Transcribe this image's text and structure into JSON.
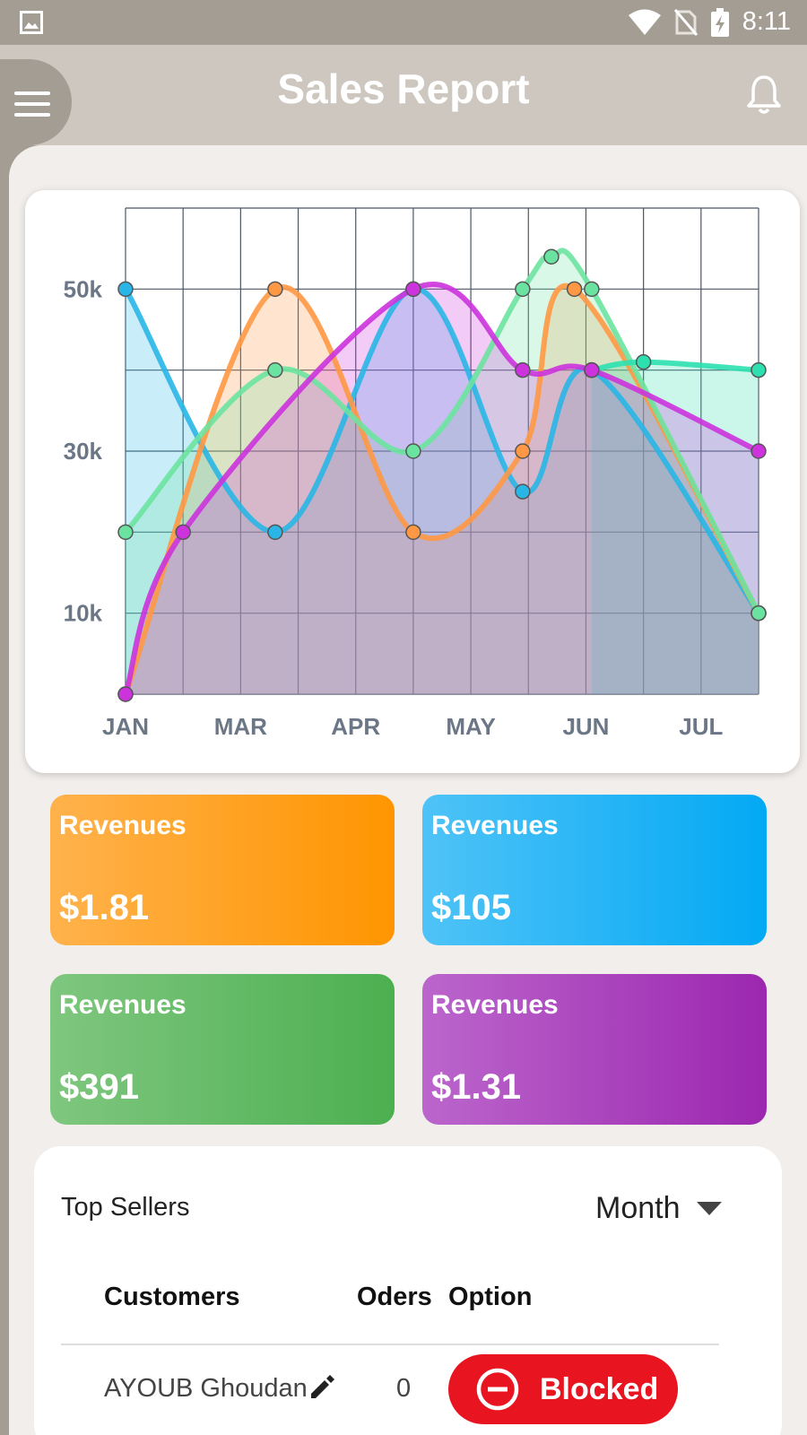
{
  "status_bar": {
    "time": "8:11"
  },
  "header": {
    "title": "Sales Report"
  },
  "colors": {
    "blue": "#29b6e6",
    "orange": "#ff9844",
    "green": "#4cc46a",
    "mint": "#6be3a0",
    "teal": "#2ee0b0",
    "purple": "#cc33dd",
    "grid": "#4b5664",
    "axis_text": "#6b7787"
  },
  "chart_data": {
    "type": "area",
    "x_tick_labels": [
      "JAN",
      "MAR",
      "APR",
      "MAY",
      "JUN",
      "JUL"
    ],
    "y_tick_labels": [
      "50k",
      "30k",
      "10k"
    ],
    "y_ticks": [
      50000,
      30000,
      10000
    ],
    "ylim": [
      0,
      60000
    ],
    "x_index_range": [
      0,
      11
    ],
    "grid": true,
    "series": [
      {
        "color": "#29b6e6",
        "points": [
          [
            0,
            50000
          ],
          [
            2.6,
            20000
          ],
          [
            5,
            50000
          ],
          [
            6.9,
            25000
          ],
          [
            8.1,
            40000
          ],
          [
            11,
            10000
          ]
        ]
      },
      {
        "color": "#ff9844",
        "points": [
          [
            0,
            0
          ],
          [
            2.6,
            50000
          ],
          [
            5,
            20000
          ],
          [
            6.9,
            30000
          ],
          [
            7.8,
            50000
          ],
          [
            11,
            10000
          ]
        ]
      },
      {
        "color": "#6be3a0",
        "points": [
          [
            0,
            20000
          ],
          [
            2.6,
            40000
          ],
          [
            5,
            30000
          ],
          [
            6.9,
            50000
          ],
          [
            7.4,
            54000
          ],
          [
            8.1,
            50000
          ],
          [
            11,
            10000
          ]
        ]
      },
      {
        "color": "#2ee0b0",
        "points": [
          [
            8.1,
            40000
          ],
          [
            9,
            41000
          ],
          [
            11,
            40000
          ]
        ]
      },
      {
        "color": "#cc33dd",
        "points": [
          [
            0,
            0
          ],
          [
            1,
            20000
          ],
          [
            5,
            50000
          ],
          [
            6.9,
            40000
          ],
          [
            8.1,
            40000
          ],
          [
            11,
            30000
          ]
        ]
      }
    ]
  },
  "revenue_cards": [
    {
      "label": "Revenues",
      "value": "$1.81"
    },
    {
      "label": "Revenues",
      "value": "$105"
    },
    {
      "label": "Revenues",
      "value": "$391"
    },
    {
      "label": "Revenues",
      "value": "$1.31"
    }
  ],
  "top_sellers": {
    "title": "Top Sellers",
    "period": "Month",
    "columns": [
      "Customers",
      "Oders",
      "Option"
    ],
    "rows": [
      {
        "customer": "AYOUB Ghoudan",
        "orders": "0",
        "option": "Blocked"
      }
    ]
  }
}
